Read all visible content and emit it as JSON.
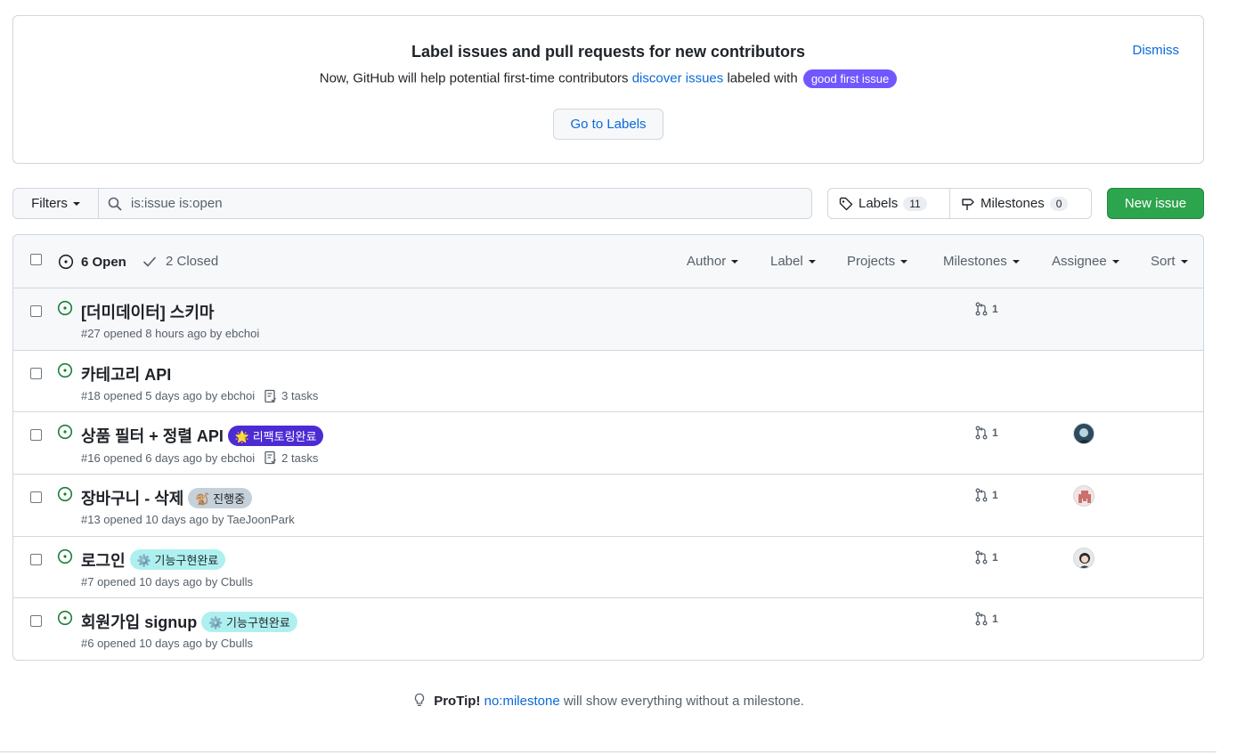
{
  "banner": {
    "title": "Label issues and pull requests for new contributors",
    "desc_prefix": "Now, GitHub will help potential first-time contributors",
    "desc_link": "discover issues",
    "desc_mid": "labeled with",
    "badge": "good first issue",
    "dismiss": "Dismiss",
    "button": "Go to Labels"
  },
  "toolbar": {
    "filters_label": "Filters",
    "search_value": "is:issue is:open",
    "labels_label": "Labels",
    "labels_count": "11",
    "milestones_label": "Milestones",
    "milestones_count": "0",
    "new_issue_label": "New issue"
  },
  "header": {
    "open_label": "6 Open",
    "closed_label": "2 Closed",
    "filters": [
      "Author",
      "Label",
      "Projects",
      "Milestones",
      "Assignee",
      "Sort"
    ]
  },
  "issues": [
    {
      "title": "[더미데이터] 스키마",
      "meta": "#27 opened 8 hours ago by ebchoi",
      "tasks": "",
      "label": "",
      "pr_count": "1"
    },
    {
      "title": "카테고리 API",
      "meta": "#18 opened 5 days ago by ebchoi",
      "tasks": "3 tasks",
      "label": "",
      "pr_count": ""
    },
    {
      "title": "상품 필터 + 정렬 API",
      "meta": "#16 opened 6 days ago by ebchoi",
      "tasks": "2 tasks",
      "label": "🌟 리팩토링완료",
      "pr_count": "1"
    },
    {
      "title": "장바구니 - 삭제",
      "meta": "#13 opened 10 days ago by TaeJoonPark",
      "tasks": "",
      "label": "🐒 진행중",
      "pr_count": "1"
    },
    {
      "title": "로그인",
      "meta": "#7 opened 10 days ago by Cbulls",
      "tasks": "",
      "label": "⚙️ 기능구현완료",
      "pr_count": "1"
    },
    {
      "title": "회원가입 signup",
      "meta": "#6 opened 10 days ago by Cbulls",
      "tasks": "",
      "label": "⚙️ 기능구현완료",
      "pr_count": "1"
    }
  ],
  "label_colors": {
    "refactor": "#4c2bd4",
    "progress": "#c5d0d9",
    "feature": "#aef0ef"
  },
  "protip": {
    "strong": "ProTip!",
    "link": "no:milestone",
    "rest": "will show everything without a milestone."
  },
  "colors": {
    "accent": "#0969da",
    "new_issue_bg": "#2da44e",
    "open_icon": "#1a7f37",
    "badge_bg": "#7057ff"
  }
}
